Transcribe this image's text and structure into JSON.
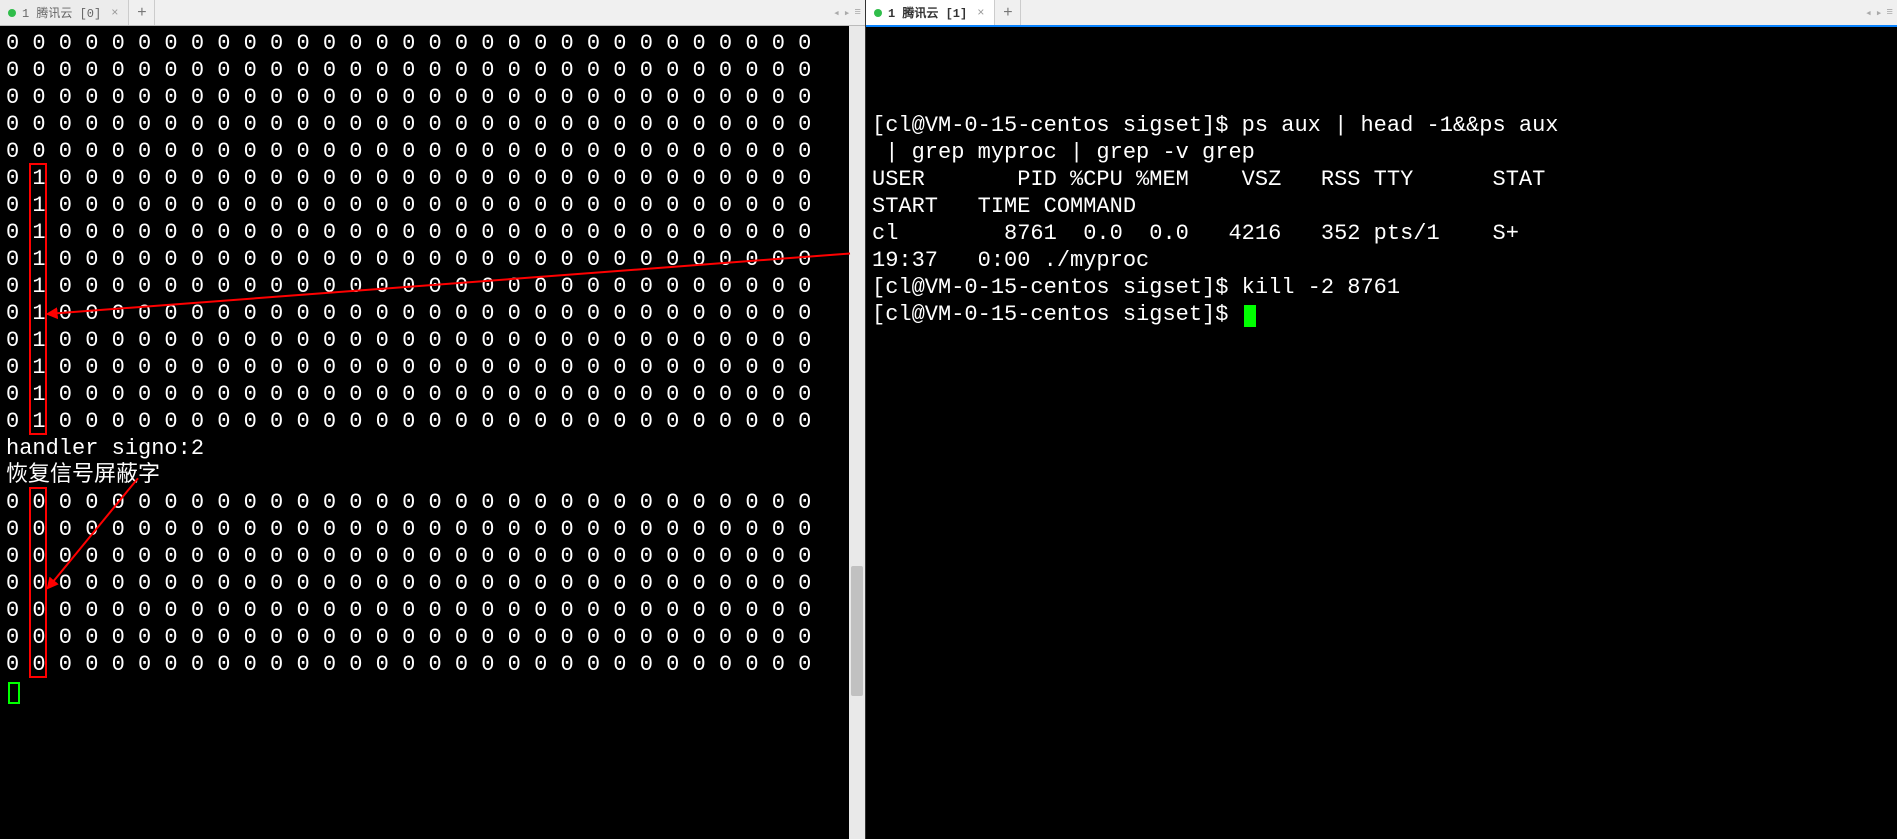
{
  "tabs": {
    "left": {
      "label": "1 腾讯云 [0]"
    },
    "right": {
      "label": "1 腾讯云 [1]"
    },
    "add_label": "+"
  },
  "nav": {
    "prev": "◂",
    "next": "▸",
    "menu": "≡"
  },
  "left_terminal": {
    "zero_row": "0 0 0 0 0 0 0 0 0 0 0 0 0 0 0 0 0 0 0 0 0 0 0 0 0 0 0 0 0 0 0",
    "one_row": "0 1 0 0 0 0 0 0 0 0 0 0 0 0 0 0 0 0 0 0 0 0 0 0 0 0 0 0 0 0 0",
    "handler_line": "handler signo:2",
    "restore_line": "恢复信号屏蔽字",
    "top_zero_count": 5,
    "one_count": 10,
    "bottom_zero_count": 7
  },
  "right_terminal": {
    "lines": [
      "[cl@VM-0-15-centos sigset]$ ps aux | head -1&&ps aux",
      " | grep myproc | grep -v grep",
      "USER       PID %CPU %MEM    VSZ   RSS TTY      STAT",
      "START   TIME COMMAND",
      "cl        8761  0.0  0.0   4216   352 pts/1    S+  ",
      "19:37   0:00 ./myproc",
      "[cl@VM-0-15-centos sigset]$ kill -2 8761",
      "[cl@VM-0-15-centos sigset]$ "
    ]
  },
  "colors": {
    "red": "#ff0000",
    "cursor": "#00ff00"
  }
}
